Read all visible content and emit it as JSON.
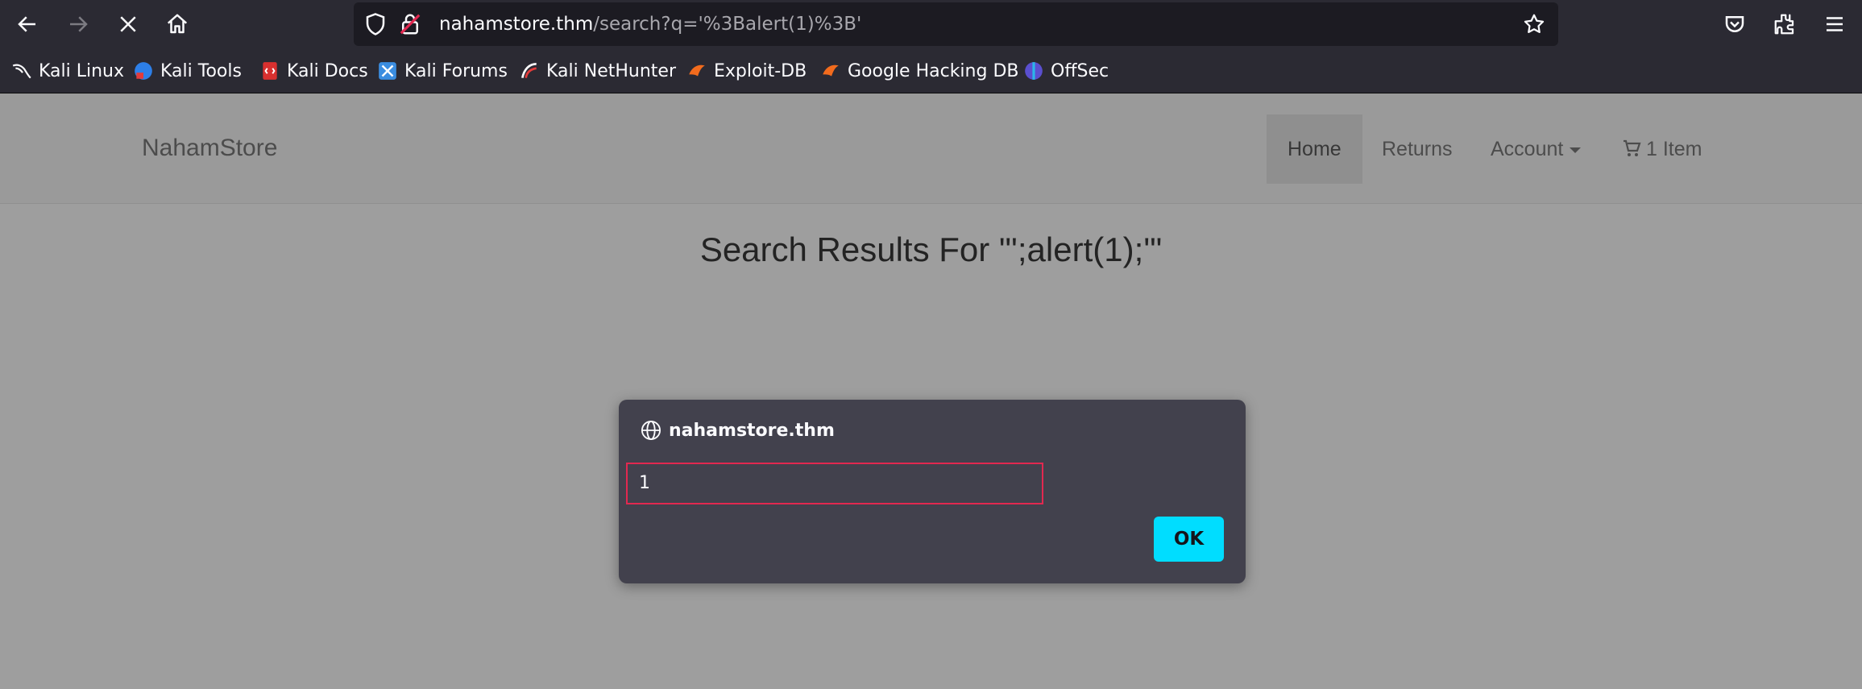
{
  "browser": {
    "url_host": "nahamstore.thm",
    "url_path": "/search?q='%3Balert(1)%3B'"
  },
  "bookmarks": [
    {
      "label": "Kali Linux",
      "icon": "kali-dragon-icon"
    },
    {
      "label": "Kali Tools",
      "icon": "kali-tools-icon"
    },
    {
      "label": "Kali Docs",
      "icon": "kali-docs-icon"
    },
    {
      "label": "Kali Forums",
      "icon": "kali-forums-icon"
    },
    {
      "label": "Kali NetHunter",
      "icon": "kali-nethunter-icon"
    },
    {
      "label": "Exploit-DB",
      "icon": "exploit-db-icon"
    },
    {
      "label": "Google Hacking DB",
      "icon": "ghdb-icon"
    },
    {
      "label": "OffSec",
      "icon": "offsec-icon"
    }
  ],
  "site": {
    "brand": "NahamStore",
    "nav": {
      "home": "Home",
      "returns": "Returns",
      "account": "Account",
      "cart": "1 Item"
    },
    "search_title": "Search Results For \"';alert(1);'\""
  },
  "dialog": {
    "origin": "nahamstore.thm",
    "message": "1",
    "ok_label": "OK"
  },
  "colors": {
    "accent_button": "#00ddff",
    "dialog_bg": "#42414d",
    "focus_outline": "#e22850"
  }
}
